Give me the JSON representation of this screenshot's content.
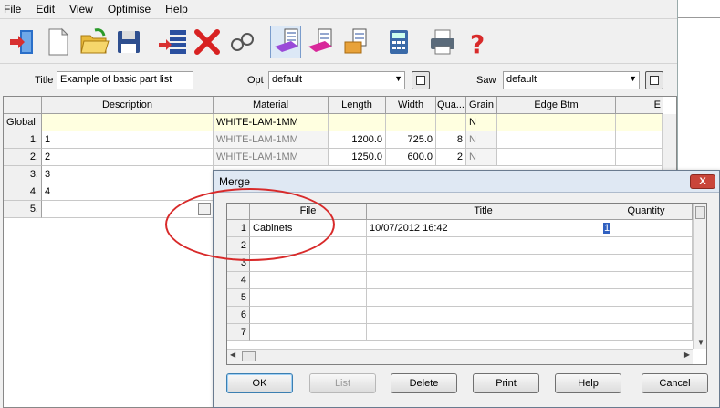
{
  "menu": [
    "File",
    "Edit",
    "View",
    "Optimise",
    "Help"
  ],
  "toolbar_icons": [
    "import-icon",
    "new-icon",
    "open-icon",
    "save-icon",
    "insert-row-icon",
    "delete-icon",
    "search-icon",
    "parts-list-icon",
    "parts-colour-icon",
    "parts-board-icon",
    "calculator-icon",
    "print-icon",
    "help-icon"
  ],
  "header": {
    "title_label": "Title",
    "title_value": "Example of basic part list",
    "opt_label": "Opt",
    "opt_value": "default",
    "saw_label": "Saw",
    "saw_value": "default"
  },
  "grid": {
    "columns": [
      "Description",
      "Material",
      "Length",
      "Width",
      "Qua...",
      "Grain",
      "Edge Btm",
      "E"
    ],
    "rows": [
      {
        "hdr": "Global",
        "desc": "",
        "material": "WHITE-LAM-1MM",
        "length": "",
        "width": "",
        "qty": "",
        "grain": "N"
      },
      {
        "hdr": "1.",
        "desc": "1",
        "material": "WHITE-LAM-1MM",
        "length": "1200.0",
        "width": "725.0",
        "qty": "8",
        "grain": "N"
      },
      {
        "hdr": "2.",
        "desc": "2",
        "material": "WHITE-LAM-1MM",
        "length": "1250.0",
        "width": "600.0",
        "qty": "2",
        "grain": "N"
      },
      {
        "hdr": "3.",
        "desc": "3"
      },
      {
        "hdr": "4.",
        "desc": "4"
      },
      {
        "hdr": "5.",
        "desc": ""
      }
    ]
  },
  "merge": {
    "title": "Merge",
    "close": "X",
    "columns": [
      "File",
      "Title",
      "Quantity"
    ],
    "rows": [
      {
        "n": "1",
        "file": "Cabinets",
        "title": "10/07/2012 16:42",
        "qty": "1"
      },
      {
        "n": "2"
      },
      {
        "n": "3"
      },
      {
        "n": "4"
      },
      {
        "n": "5"
      },
      {
        "n": "6"
      },
      {
        "n": "7"
      }
    ],
    "buttons": {
      "ok": "OK",
      "list": "List",
      "delete": "Delete",
      "print": "Print",
      "help": "Help",
      "cancel": "Cancel"
    }
  },
  "colors": {
    "annotation": "#d82a2a",
    "global_row": "#ffffe0",
    "selection": "#3060c0"
  }
}
